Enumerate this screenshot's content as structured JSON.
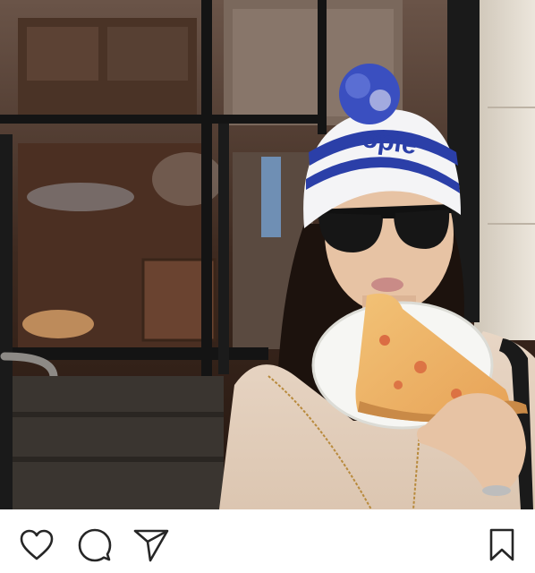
{
  "post": {
    "photo_alt": "photo",
    "hat_text": "opie"
  },
  "actions": {
    "like_icon": "heart-icon",
    "comment_icon": "speech-bubble-icon",
    "share_icon": "paper-plane-icon",
    "save_icon": "bookmark-icon"
  },
  "colors": {
    "icon_stroke": "#262626",
    "background": "#ffffff",
    "hat_blue": "#2b3fa8"
  }
}
